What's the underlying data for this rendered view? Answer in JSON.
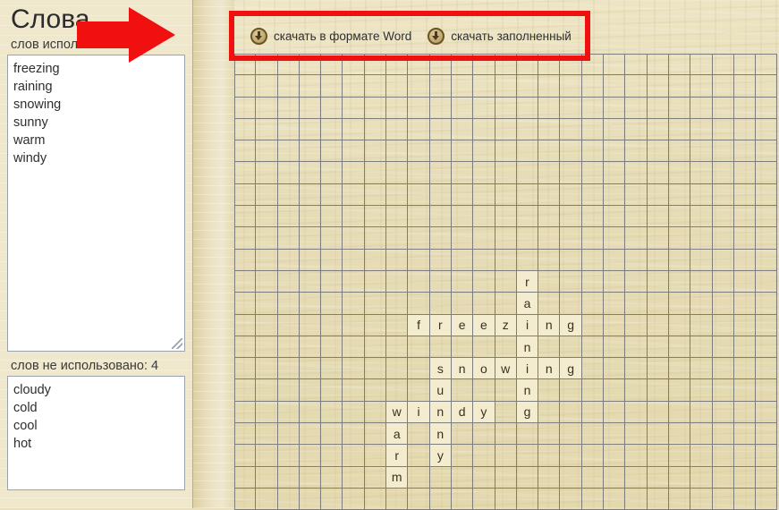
{
  "sidebar": {
    "title": "Слова",
    "used_label": "слов использовано: 6",
    "used_words": [
      "freezing",
      "raining",
      "snowing",
      "sunny",
      "warm",
      "windy"
    ],
    "unused_label": "слов не использовано: 4",
    "unused_words": [
      "cloudy",
      "cold",
      "cool",
      "hot"
    ]
  },
  "toolbar": {
    "download_word_label": "скачать в формате Word",
    "download_filled_label": "скачать заполненный",
    "icon": "download-circle-icon"
  },
  "annotations": {
    "arrow_color": "#f01010",
    "rect_color": "#f01010"
  },
  "grid": {
    "columns": 25,
    "rows": 21,
    "cell_size": 24.3,
    "cell_fill_color": "#f3ecce",
    "line_color": "#7d7d7d",
    "entries": [
      {
        "word": "raining",
        "row": 10,
        "col": 13,
        "dir": "down"
      },
      {
        "word": "freezing",
        "row": 12,
        "col": 8,
        "dir": "across"
      },
      {
        "word": "snowing",
        "row": 14,
        "col": 9,
        "dir": "across"
      },
      {
        "word": "sunny",
        "row": 14,
        "col": 9,
        "dir": "down"
      },
      {
        "word": "windy",
        "row": 16,
        "col": 7,
        "dir": "across"
      },
      {
        "word": "warm",
        "row": 16,
        "col": 7,
        "dir": "down"
      }
    ]
  }
}
